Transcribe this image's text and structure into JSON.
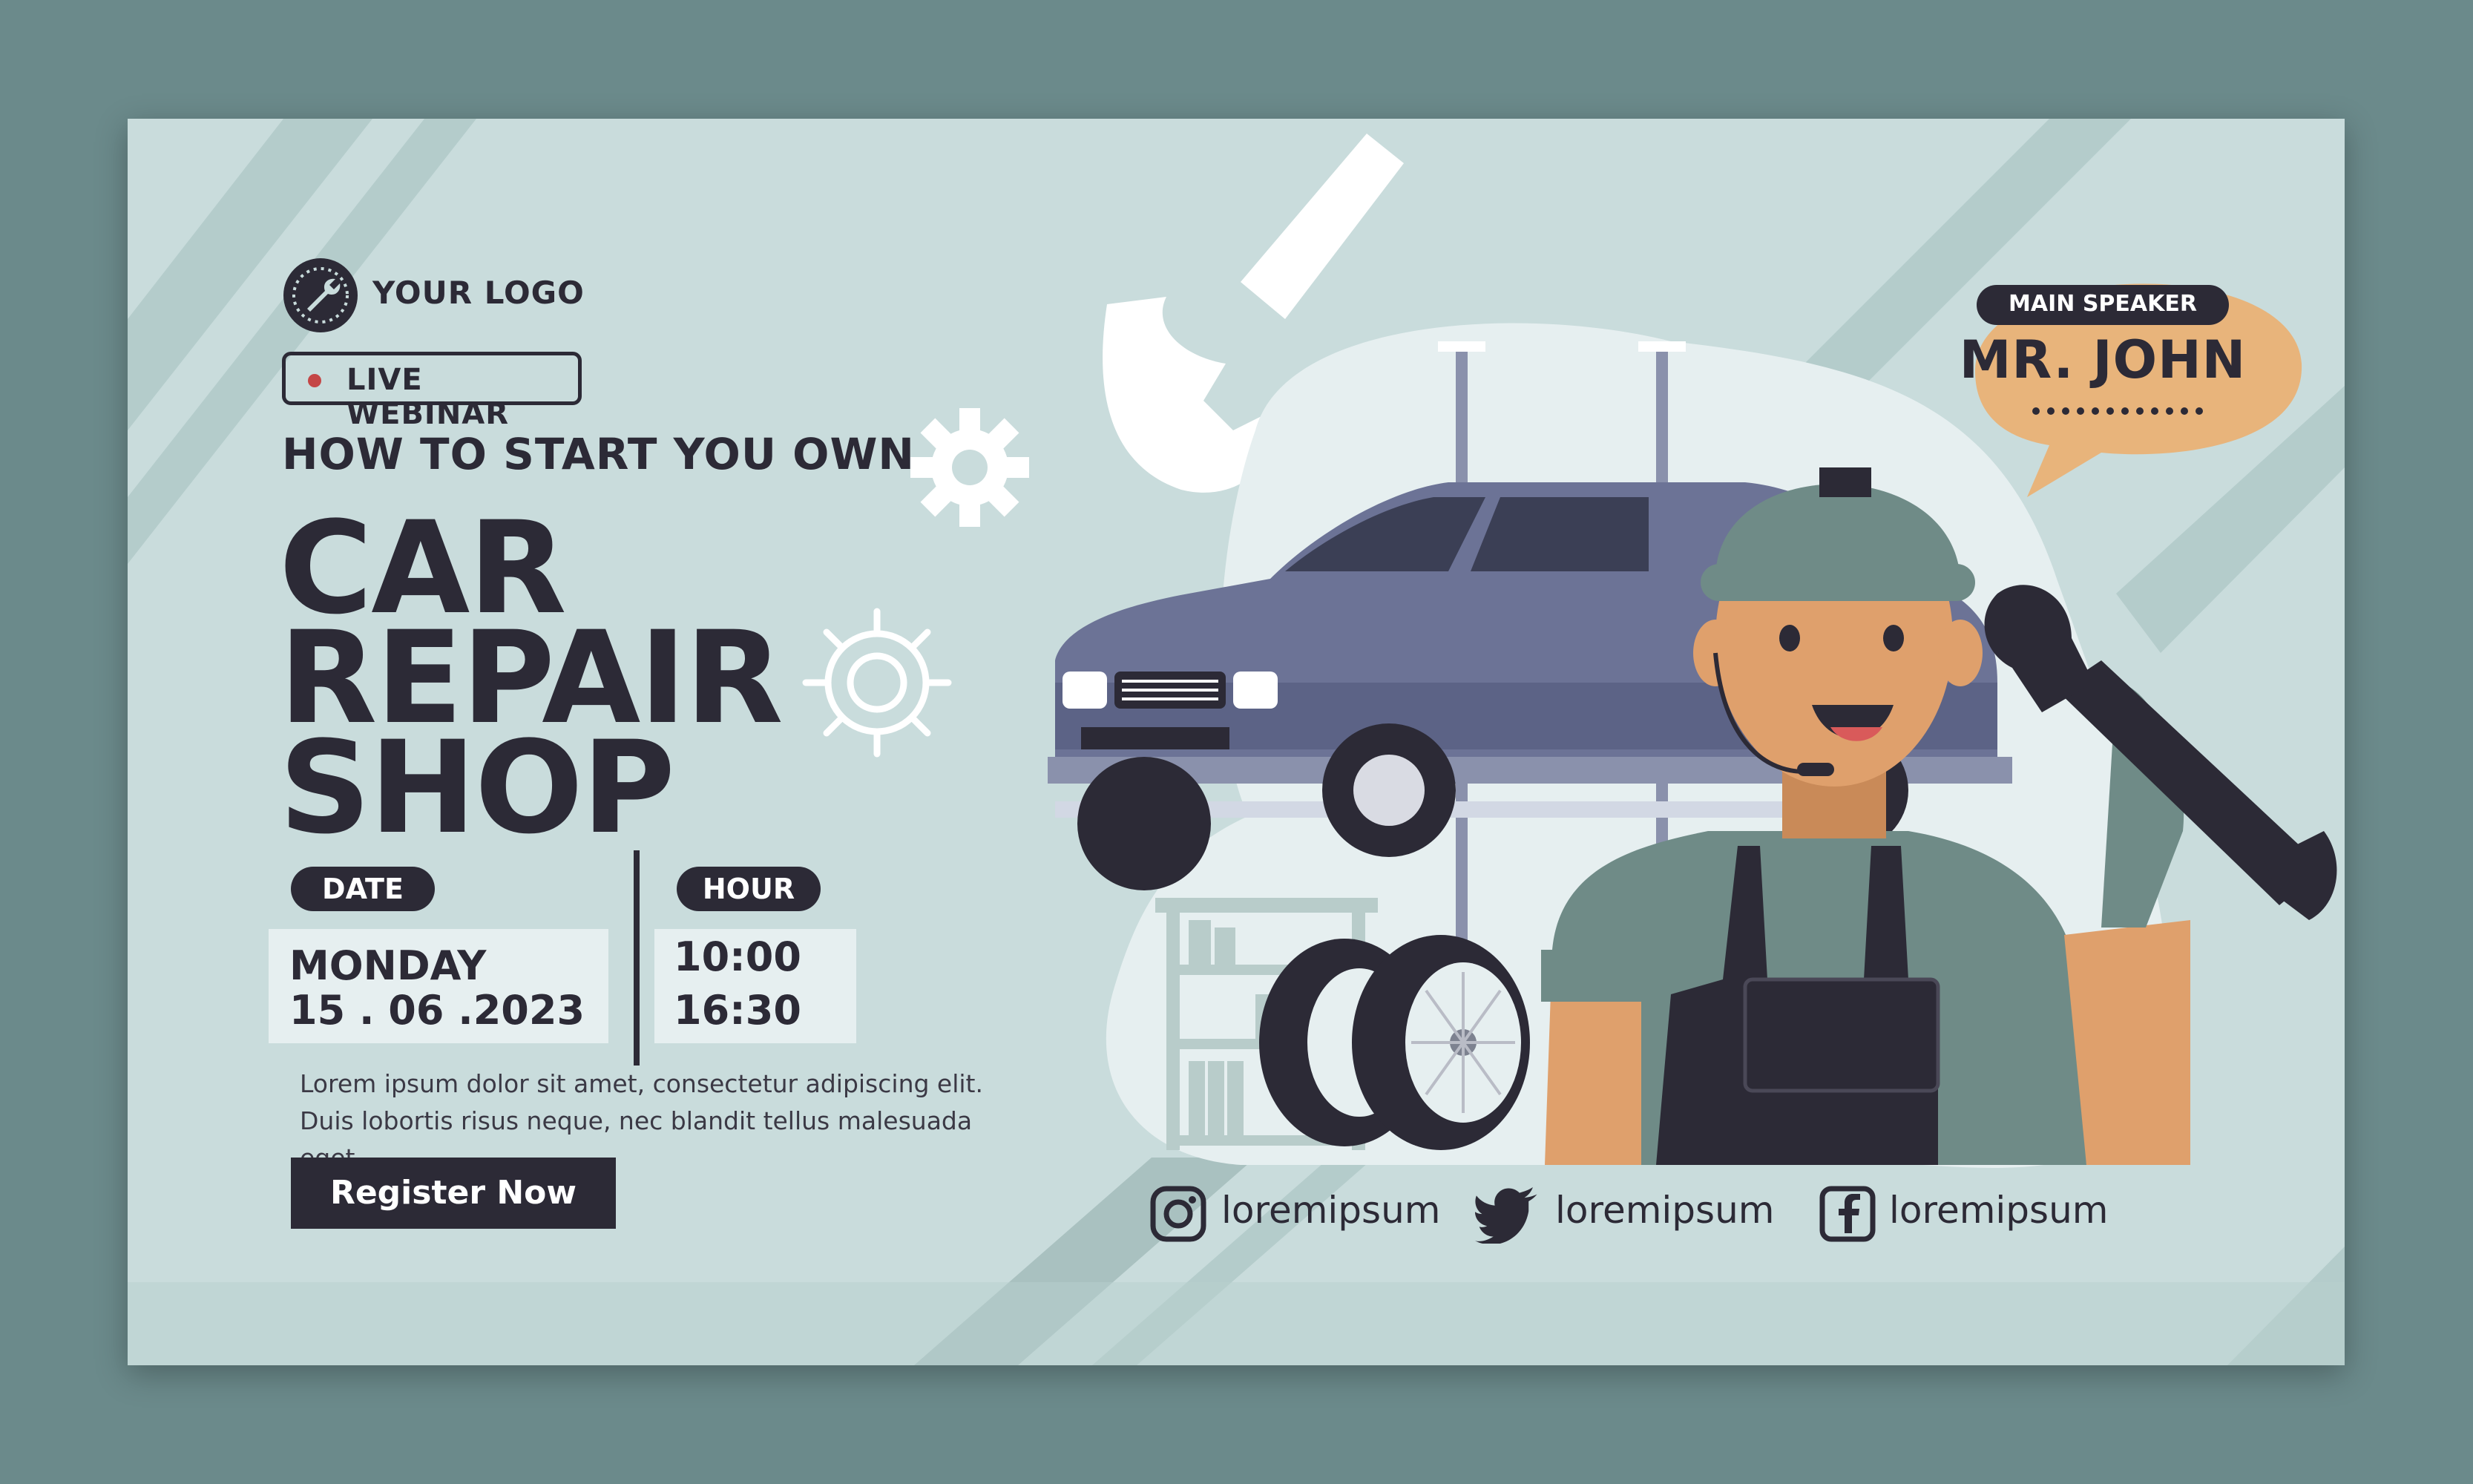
{
  "logo": {
    "text": "YOUR LOGO",
    "icon": "wrench-logo-icon"
  },
  "badge": {
    "text": "LIVE WEBINAR"
  },
  "headline": {
    "subtitle": "HOW TO START YOU OWN",
    "title_lines": [
      "CAR",
      "REPAIR",
      "SHOP"
    ]
  },
  "schedule": {
    "date_label": "DATE",
    "date_day": "MONDAY",
    "date_value": "15 . 06 .2023",
    "hour_label": "HOUR",
    "hour_start": "10:00",
    "hour_end": "16:30"
  },
  "description": "Lorem ipsum dolor sit amet, consectetur adipiscing elit. Duis lobortis risus neque, nec blandit tellus malesuada eget.",
  "cta": {
    "label": "Register Now"
  },
  "speaker": {
    "label": "MAIN SPEAKER",
    "name": "MR. JOHN"
  },
  "social": [
    {
      "icon": "instagram-icon",
      "handle": "loremipsum"
    },
    {
      "icon": "twitter-icon",
      "handle": "loremipsum"
    },
    {
      "icon": "facebook-icon",
      "handle": "loremipsum"
    }
  ],
  "colors": {
    "background": "#6b8a8b",
    "banner": "#c9dcdc",
    "dark": "#2c2a36",
    "accent_bubble": "#e8b47b",
    "live_dot": "#c44646",
    "car": "#6c7396",
    "uniform": "#6f8b87"
  }
}
